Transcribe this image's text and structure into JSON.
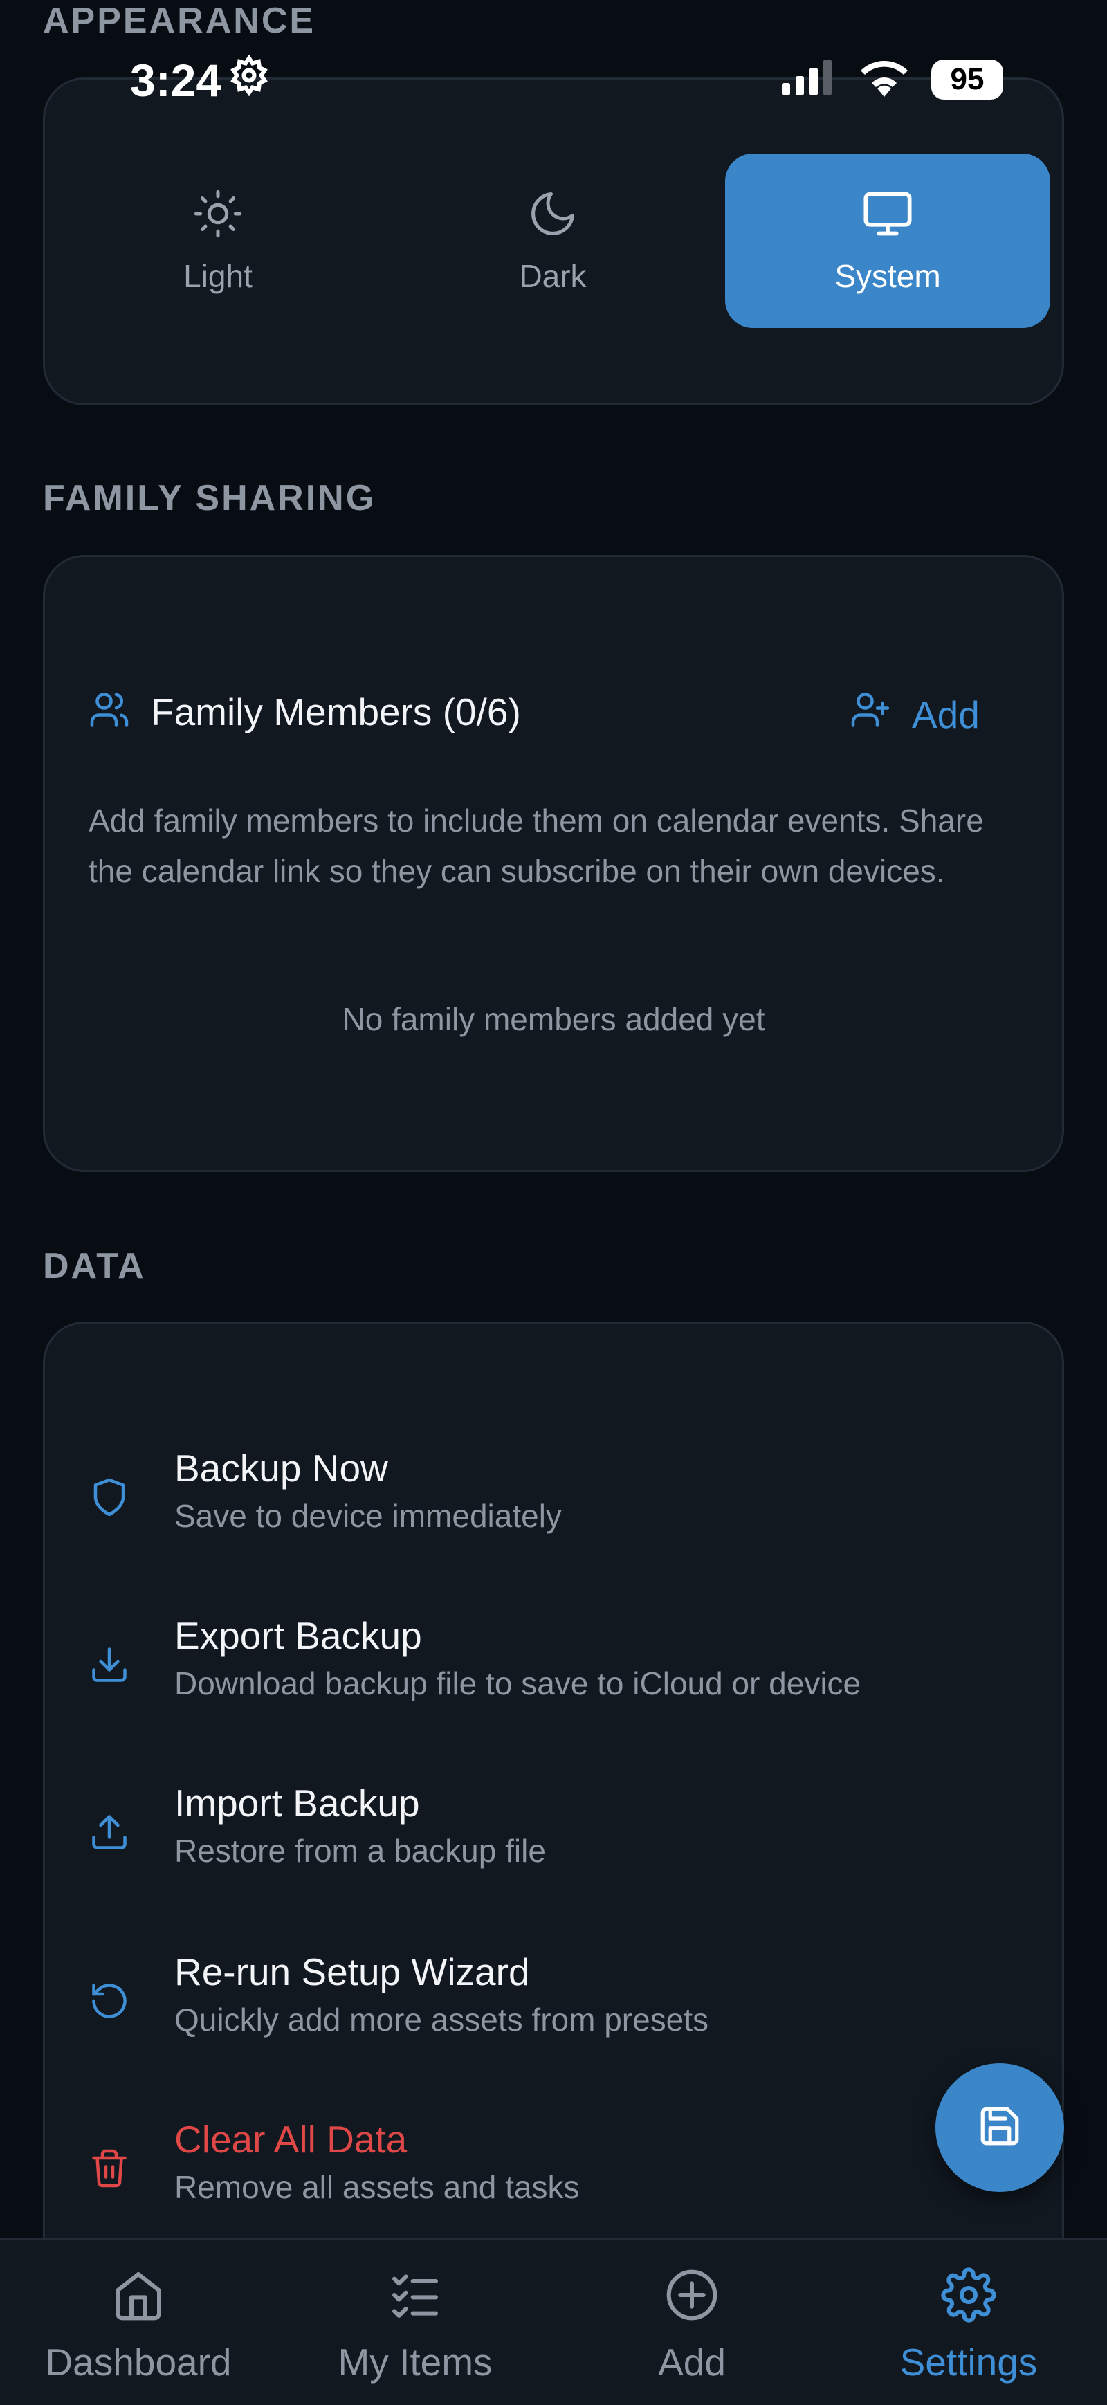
{
  "status_bar": {
    "time": "3:24",
    "battery": "95"
  },
  "appearance": {
    "label": "APPEARANCE",
    "options": [
      {
        "label": "Light",
        "icon": "sun-icon",
        "selected": false
      },
      {
        "label": "Dark",
        "icon": "moon-icon",
        "selected": false
      },
      {
        "label": "System",
        "icon": "monitor-icon",
        "selected": true
      }
    ]
  },
  "family": {
    "label": "FAMILY SHARING",
    "title": "Family Members (0/6)",
    "add_label": "Add",
    "description": "Add family members to include them on calendar events. Share the calendar link so they can subscribe on their own devices.",
    "empty_text": "No family members added yet"
  },
  "data": {
    "label": "DATA",
    "rows": [
      {
        "title": "Backup Now",
        "subtitle": "Save to device immediately",
        "icon": "shield-icon"
      },
      {
        "title": "Export Backup",
        "subtitle": "Download backup file to save to iCloud or device",
        "icon": "download-icon"
      },
      {
        "title": "Import Backup",
        "subtitle": "Restore from a backup file",
        "icon": "upload-icon"
      },
      {
        "title": "Re-run Setup Wizard",
        "subtitle": "Quickly add more assets from presets",
        "icon": "rotate-ccw-icon"
      },
      {
        "title": "Clear All Data",
        "subtitle": "Remove all assets and tasks",
        "icon": "trash-icon"
      }
    ]
  },
  "bottom_nav": [
    {
      "label": "Dashboard",
      "icon": "home-icon",
      "active": false
    },
    {
      "label": "My Items",
      "icon": "checklist-icon",
      "active": false
    },
    {
      "label": "Add",
      "icon": "plus-circle-icon",
      "active": false
    },
    {
      "label": "Settings",
      "icon": "gear-icon",
      "active": true
    }
  ],
  "colors": {
    "accent": "#3b86c8",
    "danger": "#e04848",
    "background": "#080d14",
    "card": "#111820"
  }
}
